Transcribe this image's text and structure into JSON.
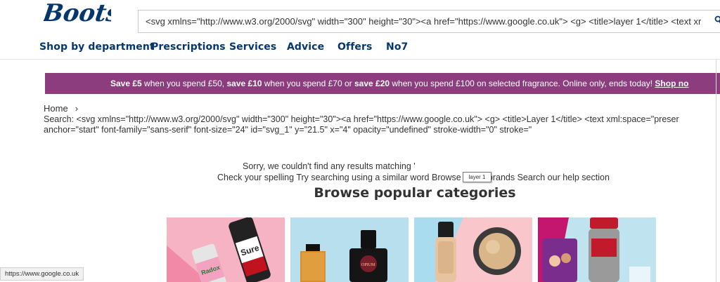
{
  "header": {
    "logo_text": "Boots",
    "search_value": "<svg xmlns=\"http://www.w3.org/2000/svg\" width=\"300\" height=\"30\"><a href=\"https://www.google.co.uk\"> <g> <title>layer 1</title> <text xr"
  },
  "nav": {
    "items": [
      {
        "label": "Shop by department"
      },
      {
        "label": "Prescriptions"
      },
      {
        "label": "Services"
      },
      {
        "label": "Advice"
      },
      {
        "label": "Offers"
      },
      {
        "label": "No7"
      }
    ]
  },
  "promo": {
    "bold1": "Save £5",
    "text1": " when you spend £50, ",
    "bold2": "save £10",
    "text2": " when you spend £70 or ",
    "bold3": "save £20",
    "text3": " when you spend £100 on selected fragrance. Online only, ends today! ",
    "link": "Shop no"
  },
  "breadcrumb": {
    "home": "Home",
    "separator": "›"
  },
  "search_echo": {
    "line1": "Search: <svg xmlns=\"http://www.w3.org/2000/svg\" width=\"300\" height=\"30\"><a href=\"https://www.google.co.uk\"> <g> <title>Layer 1</title> <text xml:space=\"preser",
    "line2": "anchor=\"start\" font-family=\"sans-serif\" font-size=\"24\" id=\"svg_1\" y=\"21.5\" x=\"4\" opacity=\"undefined\" stroke-width=\"0\" stroke=\""
  },
  "no_results": {
    "line1": "Sorry, we couldn't find any results matching '",
    "line2": "Check your spelling Try searching using a similar word Browse 6,000 brands Search our help section"
  },
  "tooltip": "layer 1",
  "browse": {
    "title": "Browse popular categories"
  },
  "status_bar": "https://www.google.co.uk",
  "colors": {
    "brand_navy": "#05366c",
    "promo_purple": "#8b3d7d"
  },
  "icons": [
    "search-icon"
  ]
}
